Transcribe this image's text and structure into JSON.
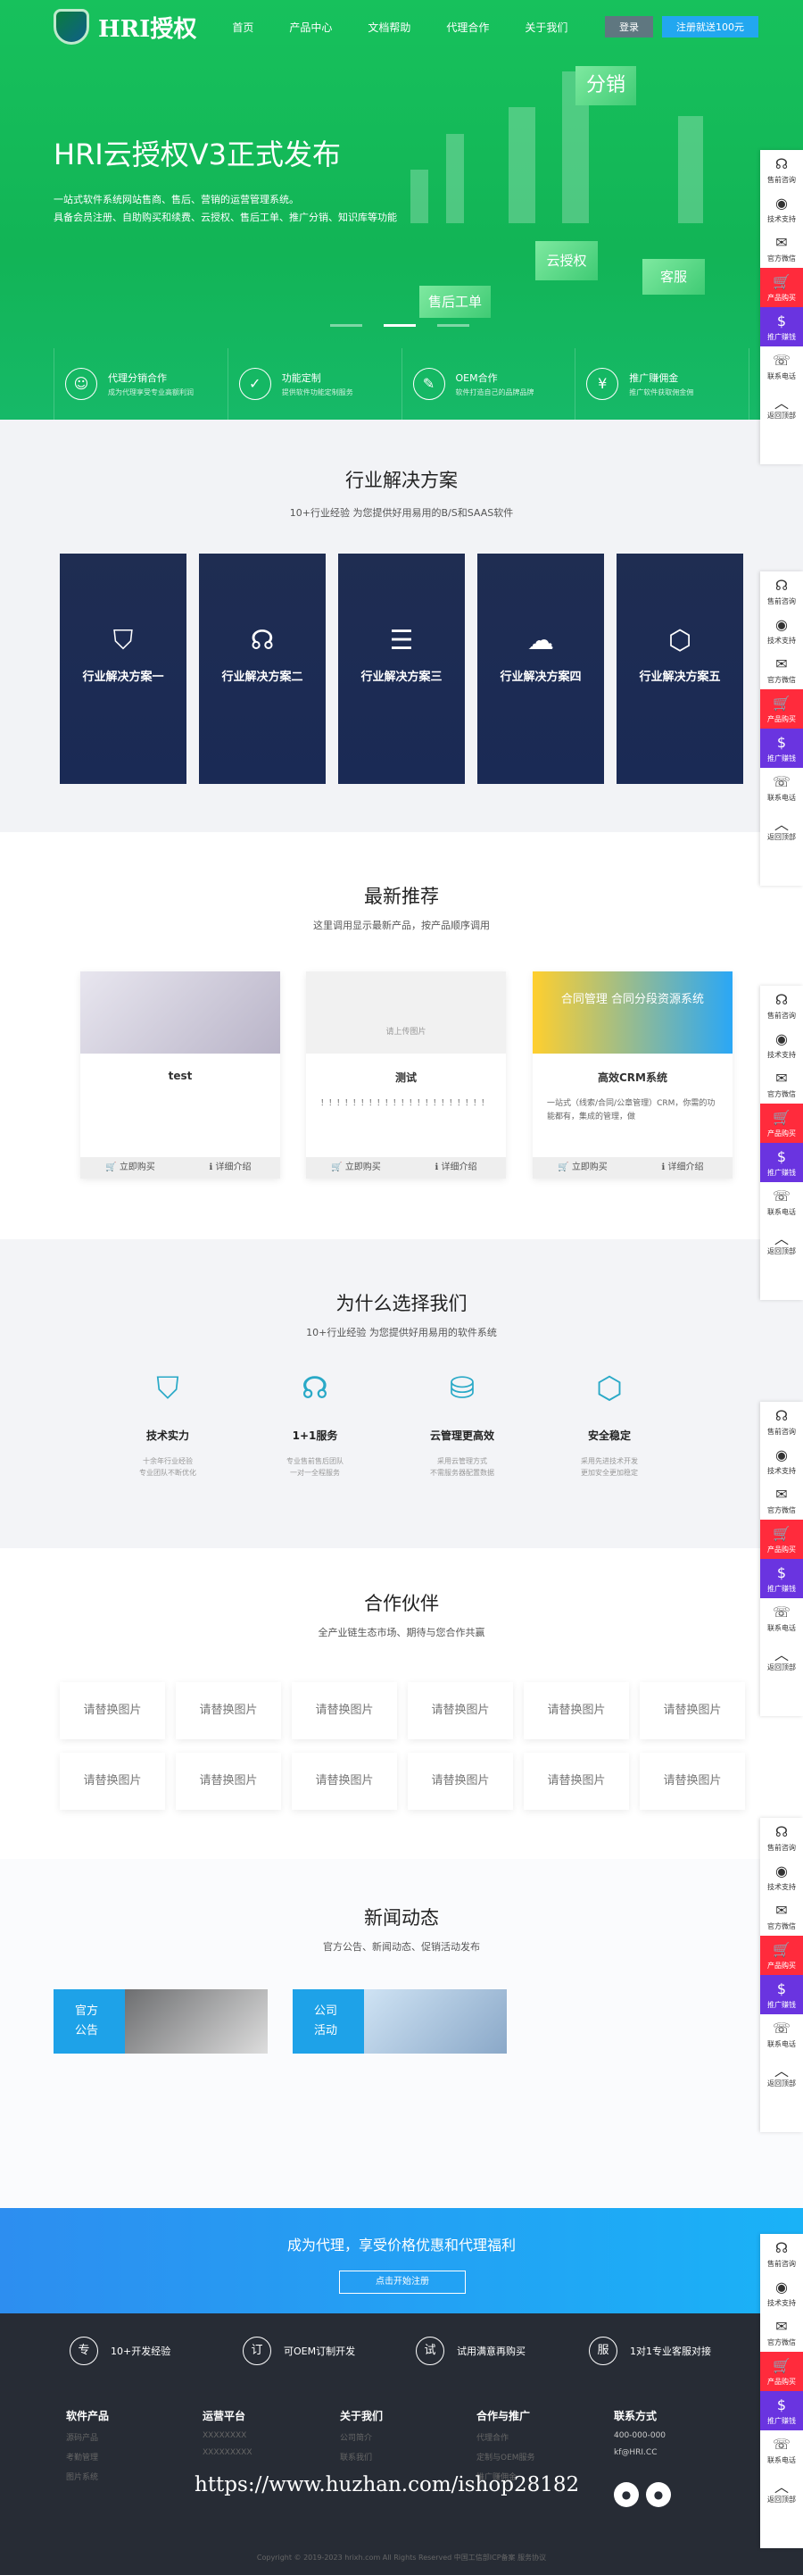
{
  "header": {
    "logo_text": "HRI授权",
    "menu": [
      "首页",
      "产品中心",
      "文档帮助",
      "代理合作",
      "关于我们"
    ],
    "login": "登录",
    "register": "注册就送100元"
  },
  "banner": {
    "title": "HRI云授权V3正式发布",
    "desc_lines": [
      "一站式软件系统网站售商、售后、营销的运营管理系统。",
      "具备会员注册、自助购买和续费、云授权、售后工单、推广分销、知识库等功能"
    ],
    "cubes": [
      "分销",
      "云授权",
      "售后工单",
      "客服"
    ]
  },
  "features": [
    {
      "title": "代理分销合作",
      "desc": "成为代理享受专业高额利润",
      "icon": "user-icon"
    },
    {
      "title": "功能定制",
      "desc": "提供软件功能定制服务",
      "icon": "check-icon"
    },
    {
      "title": "OEM合作",
      "desc": "软件打造自己的品牌品牌",
      "icon": "edit-icon"
    },
    {
      "title": "推广赚佣金",
      "desc": "推广软件获取佣金佣",
      "icon": "yen-icon"
    }
  ],
  "solutions": {
    "title": "行业解决方案",
    "subtitle": "10+行业经验 为您提供好用易用的B/S和SAAS软件",
    "items": [
      "行业解决方案一",
      "行业解决方案二",
      "行业解决方案三",
      "行业解决方案四",
      "行业解决方案五"
    ]
  },
  "recommend": {
    "title": "最新推荐",
    "subtitle": "这里调用显示最新产品，按产品顺序调用",
    "cards": [
      {
        "name": "test",
        "desc": "",
        "banner": ""
      },
      {
        "name": "测试",
        "desc": "！！！！！！！！！！！！！！！！！！！！！",
        "banner": "请上传图片"
      },
      {
        "name": "高效CRM系统",
        "desc": "一站式（线索/合同/公章管理）CRM，你需的功能都有，集成的管理，做",
        "banner": "合同管理 合同分段资源系统"
      }
    ],
    "buy": "立即购买",
    "detail": "详细介绍"
  },
  "why": {
    "title": "为什么选择我们",
    "subtitle": "10+行业经验 为您提供好用易用的软件系统",
    "items": [
      {
        "title": "技术实力",
        "desc": "十余年行业经验\n专业团队不断优化"
      },
      {
        "title": "1+1服务",
        "desc": "专业售前售后团队\n一对一全程服务"
      },
      {
        "title": "云管理更高效",
        "desc": "采用云管理方式\n不需服务器配置数据"
      },
      {
        "title": "安全稳定",
        "desc": "采用先进技术开发\n更加安全更加稳定"
      }
    ]
  },
  "partners": {
    "title": "合作伙伴",
    "subtitle": "全产业链生态市场、期待与您合作共赢",
    "placeholder": "请替换图片"
  },
  "news": {
    "title": "新闻动态",
    "subtitle": "官方公告、新闻动态、促销活动发布",
    "items": [
      "官方\n公告",
      "公司\n活动"
    ]
  },
  "agent": {
    "title": "成为代理，享受价格优惠和代理福利",
    "button": "点击开始注册"
  },
  "footer": {
    "services": [
      {
        "icon": "专",
        "label": "10+开发经验"
      },
      {
        "icon": "订",
        "label": "可OEM订制开发"
      },
      {
        "icon": "试",
        "label": "试用满意再购买"
      },
      {
        "icon": "服",
        "label": "1对1专业客服对接"
      }
    ],
    "cols": [
      {
        "title": "软件产品",
        "items": [
          "源码产品",
          "考勤管理",
          "图片系统"
        ]
      },
      {
        "title": "运营平台",
        "items": [
          "XXXXXXXX",
          "XXXXXXXXX"
        ]
      },
      {
        "title": "关于我们",
        "items": [
          "公司简介",
          "联系我们"
        ]
      },
      {
        "title": "合作与推广",
        "items": [
          "代理合作",
          "定制与OEM服务",
          "推广赚佣金"
        ]
      },
      {
        "title": "联系方式",
        "items": [
          "400-000-000",
          "kf@HRI.CC"
        ]
      }
    ],
    "watermark": "https://www.huzhan.com/ishop28182",
    "copyright": "Copyright © 2019-2023 hrixh.com All Rights Reserved 中国工信部ICP备案 服务协议"
  },
  "sidebar": [
    {
      "label": "售前咨询",
      "icon": "headset-icon"
    },
    {
      "label": "技术支持",
      "icon": "qq-icon"
    },
    {
      "label": "官方微信",
      "icon": "wechat-icon"
    },
    {
      "label": "产品购买",
      "icon": "cart-icon"
    },
    {
      "label": "推广赚钱",
      "icon": "coin-icon"
    },
    {
      "label": "联系电话",
      "icon": "phone-icon"
    },
    {
      "label": "返回顶部",
      "icon": "chevron-up-icon"
    }
  ]
}
